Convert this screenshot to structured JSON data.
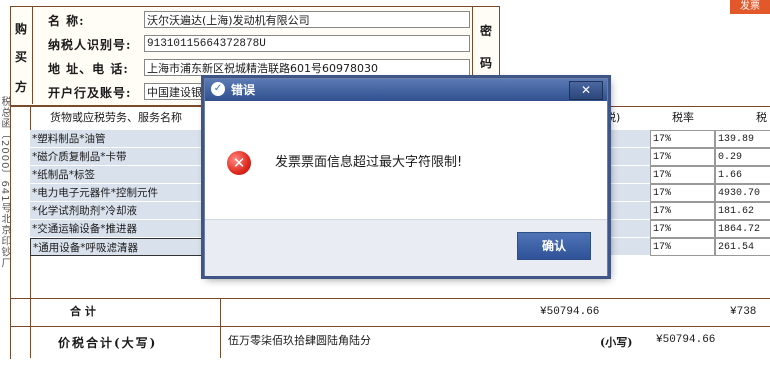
{
  "corner_tag": "发票",
  "side_note": "税总函〔2000〕641号北京印钞厂",
  "buyer": {
    "side_chars": [
      "购",
      "买",
      "方"
    ],
    "name_label": "名          称:",
    "name_value": "沃尔沃遍达(上海)发动机有限公司",
    "taxid_label": "纳税人识别号:",
    "taxid_value": "91310115664372878U",
    "addr_label": "地  址、电  话:",
    "addr_value": "上海市浦东新区祝城精浩联路601号60978030",
    "bank_label": "开户行及账号:",
    "bank_value": "中国建设银"
  },
  "mima": [
    "密",
    "码"
  ],
  "table": {
    "col_item": "货物或应税劳务、服务名称",
    "col_tail": "税)",
    "col_rate": "税率",
    "col_tax": "税",
    "rows": [
      {
        "item": "*塑料制品*油管",
        "rate": "17%",
        "tax": "139.89"
      },
      {
        "item": "*磁介质复制品*卡带",
        "rate": "17%",
        "tax": "0.29"
      },
      {
        "item": "*纸制品*标签",
        "rate": "17%",
        "tax": "1.66"
      },
      {
        "item": "*电力电子元器件*控制元件",
        "rate": "17%",
        "tax": "4930.70"
      },
      {
        "item": "*化学试剂助剂*冷却液",
        "rate": "17%",
        "tax": "181.62"
      },
      {
        "item": "*交通运输设备*推进器",
        "rate": "17%",
        "tax": "1864.72"
      },
      {
        "item": "*通用设备*呼吸滤清器",
        "rate": "17%",
        "tax": "261.54"
      }
    ]
  },
  "totals": {
    "label": "合          计",
    "amount": "¥50794.66",
    "tax": "¥738"
  },
  "grand": {
    "label": "价税合计(大写)",
    "words": "伍万零柒佰玖拾肆圆陆角陆分",
    "small_label": "(小写)",
    "small_value": "¥50794.66"
  },
  "dialog": {
    "title": "错误",
    "message": "发票票面信息超过最大字符限制!",
    "ok_label": "确认",
    "close_glyph": "✕"
  }
}
